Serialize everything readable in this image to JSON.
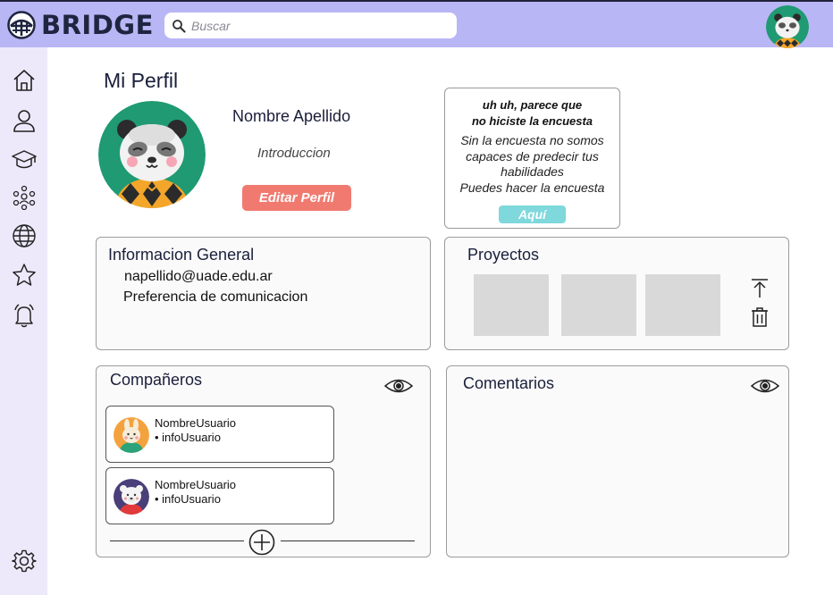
{
  "brand": {
    "name": "BRIDGE"
  },
  "search": {
    "placeholder": "Buscar",
    "icon": "search-icon"
  },
  "sidebar": {
    "items": [
      {
        "id": "home",
        "icon": "home-icon"
      },
      {
        "id": "profile",
        "icon": "user-icon"
      },
      {
        "id": "courses",
        "icon": "graduation-cap-icon"
      },
      {
        "id": "community",
        "icon": "people-network-icon"
      },
      {
        "id": "explore",
        "icon": "globe-icon"
      },
      {
        "id": "favorites",
        "icon": "star-icon"
      },
      {
        "id": "notifications",
        "icon": "bell-icon"
      }
    ],
    "settings_icon": "gear-icon"
  },
  "profile": {
    "page_title": "Mi Perfil",
    "name": "Nombre Apellido",
    "intro": "Introduccion",
    "edit_label": "Editar Perfil"
  },
  "survey": {
    "title_line1": "uh uh, parece que",
    "title_line2": "no hiciste la encuesta",
    "body_line1": "Sin la encuesta no somos",
    "body_line2": "capaces de predecir tus",
    "body_line3": "habilidades",
    "body_line4": "Puedes hacer la encuesta",
    "button_label": "Aquí"
  },
  "info_general": {
    "title": "Informacion General",
    "email": "napellido@uade.edu.ar",
    "preference": "Preferencia de comunicacion"
  },
  "proyectos": {
    "title": "Proyectos",
    "thumbnails": 3,
    "actions": [
      "upload-icon",
      "trash-icon"
    ]
  },
  "companeros": {
    "title": "Compañeros",
    "users": [
      {
        "name": "NombreUsuario",
        "info": "• infoUsuario",
        "avatar": "bunny-avatar"
      },
      {
        "name": "NombreUsuario",
        "info": "• infoUsuario",
        "avatar": "polar-bear-avatar"
      }
    ]
  },
  "comentarios": {
    "title": "Comentarios"
  },
  "colors": {
    "topbar": "#b9b6f5",
    "sidebar": "#ede9fb",
    "edit_button": "#f07a70",
    "survey_button": "#7fd8dc",
    "avatar_bg": "#1f9a73"
  }
}
